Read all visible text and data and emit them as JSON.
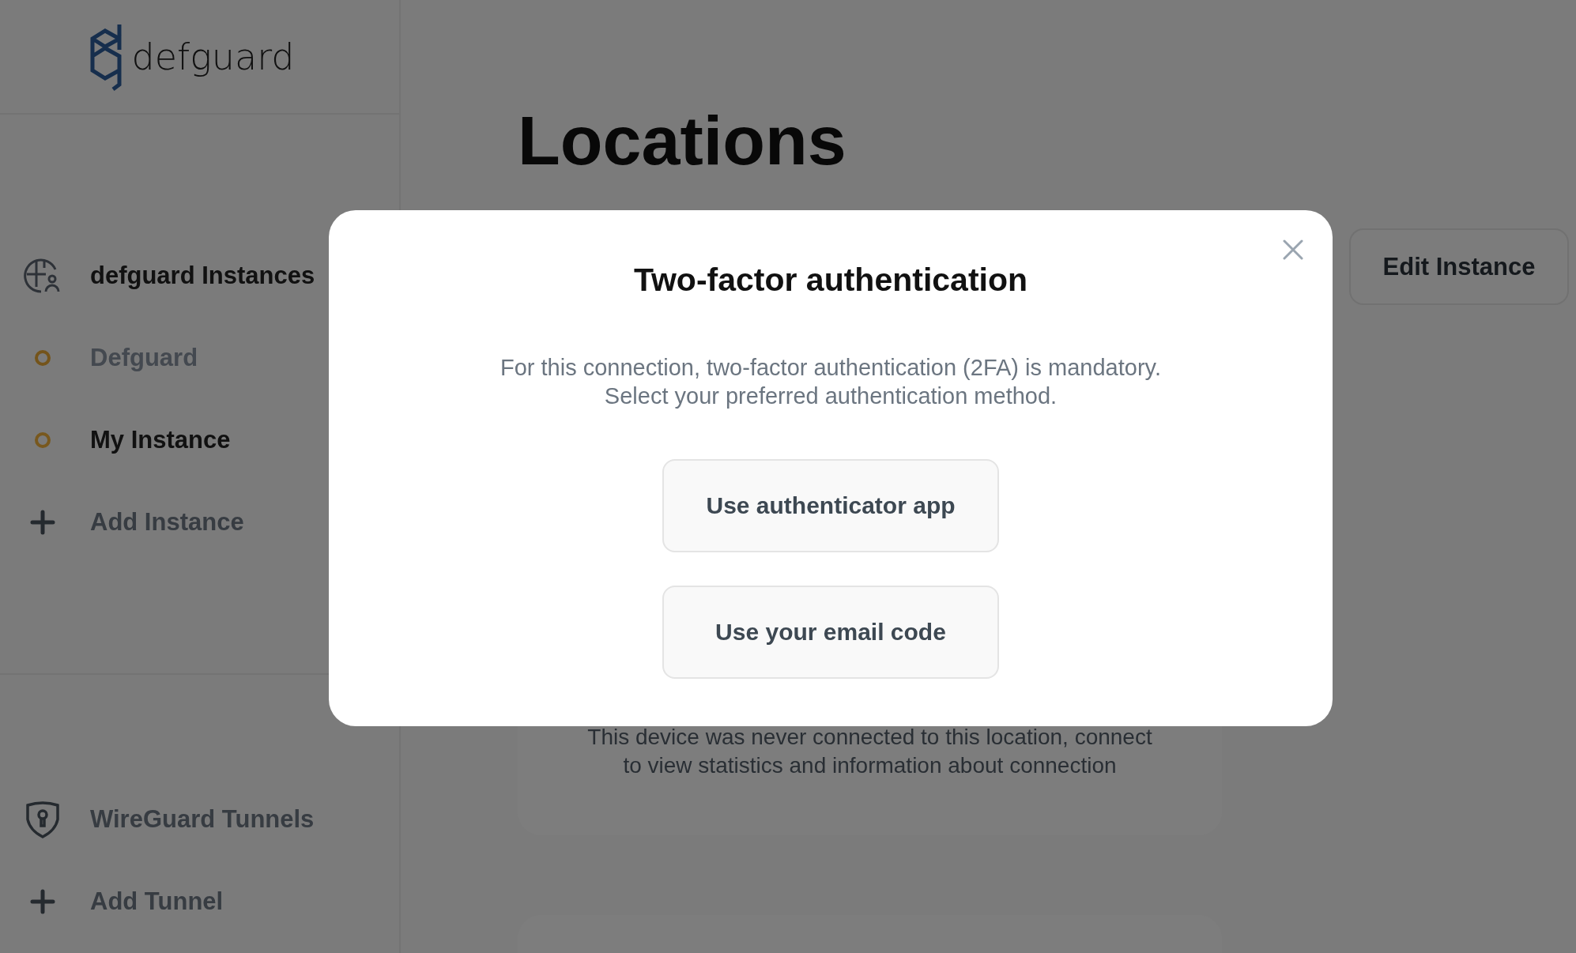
{
  "logo": {
    "text": "defguard"
  },
  "sidebar": {
    "sections": [
      {
        "kind": "instances",
        "title": "defguard Instances",
        "items": [
          {
            "kind": "instance",
            "label": "Defguard",
            "selected": false
          },
          {
            "kind": "instance",
            "label": "My Instance",
            "selected": true
          },
          {
            "kind": "add",
            "label": "Add Instance"
          }
        ]
      },
      {
        "kind": "tunnels",
        "title": "WireGuard Tunnels",
        "items": [
          {
            "kind": "add",
            "label": "Add Tunnel"
          }
        ]
      }
    ]
  },
  "page": {
    "title": "Locations",
    "edit_button": "Edit Instance",
    "card_message": "This device was never connected to this location, connect\nto view statistics and information about connection"
  },
  "modal": {
    "title": "Two-factor authentication",
    "description": "For this connection, two-factor authentication (2FA) is mandatory.\nSelect your preferred authentication method.",
    "options": [
      "Use authenticator app",
      "Use your email code"
    ]
  }
}
